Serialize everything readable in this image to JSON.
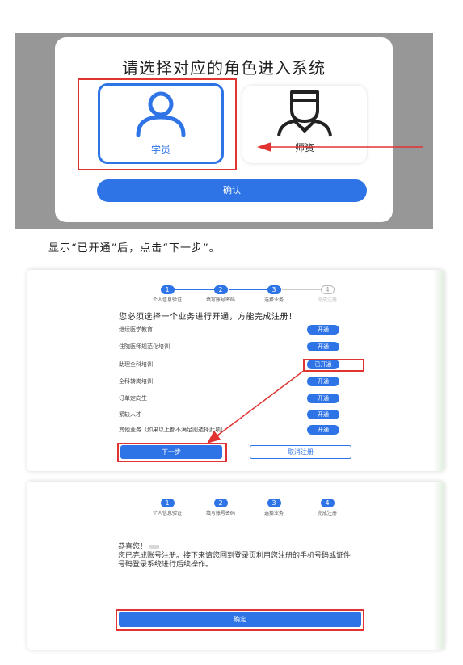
{
  "role_dialog": {
    "title": "请选择对应的角色进入系统",
    "student_label": "学员",
    "teacher_label": "师资",
    "confirm_label": "确认"
  },
  "caption": "显示“已开通”后，点击“下一步”。",
  "register": {
    "steps": [
      {
        "number": "1",
        "label": "个人信息验证"
      },
      {
        "number": "2",
        "label": "填写账号密码"
      },
      {
        "number": "3",
        "label": "选择业务"
      },
      {
        "number": "4",
        "label": "完成注册"
      }
    ],
    "notice": "您必须选择一个业务进行开通，方能完成注册！",
    "businesses": [
      {
        "name": "继续医学教育",
        "button": "开通"
      },
      {
        "name": "住院医师规范化培训",
        "button": "开通"
      },
      {
        "name": "助理全科培训",
        "button": "已开通"
      },
      {
        "name": "全科转岗培训",
        "button": "开通"
      },
      {
        "name": "订单定向生",
        "button": "开通"
      },
      {
        "name": "紧缺人才",
        "button": "开通"
      },
      {
        "name": "其他业务（如果以上都不满足则选择此项）",
        "button": "开通"
      }
    ],
    "next_label": "下一步",
    "cancel_label": "取消注册"
  },
  "complete": {
    "greeting": "恭喜您！",
    "message": "您已完成账号注册。接下来请您回到登录页利用您注册的手机号码或证件号码登录系统进行后续操作。",
    "confirm_label": "确定"
  },
  "colors": {
    "primary": "#2e74e6",
    "highlight": "#e23333",
    "frame_gray": "#979797"
  }
}
